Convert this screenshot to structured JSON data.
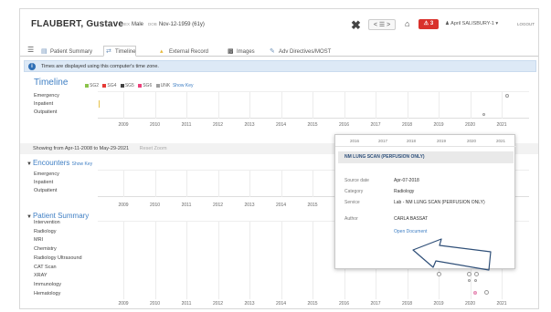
{
  "patient": {
    "name": "FLAUBERT, Gustave",
    "sex_label": "SEX",
    "sex": "Male",
    "dob_label": "DOB",
    "dob": "Nov-12-1959 (61y)"
  },
  "header": {
    "close_glyph": "✖",
    "list_glyph": "< ☰ >",
    "home_glyph": "⌂",
    "alert_count": "3",
    "user": "April SALISBURY-1",
    "logout": "LOGOUT"
  },
  "tabs": [
    {
      "label": "Patient Summary"
    },
    {
      "label": "Timeline"
    },
    {
      "label": "External Record"
    },
    {
      "label": "Images"
    },
    {
      "label": "Adv Directives/MOST"
    }
  ],
  "notice": "Times are displayed using this computer's time zone.",
  "timeline": {
    "title": "Timeline",
    "legend": [
      {
        "label": "SG2",
        "color": "#8bc34a"
      },
      {
        "label": "SG4",
        "color": "#e53935"
      },
      {
        "label": "SG5",
        "color": "#424242"
      },
      {
        "label": "SG6",
        "color": "#ec407a"
      },
      {
        "label": "UNK",
        "color": "#9e9e9e"
      }
    ],
    "show_key": "Show Key",
    "rows": [
      "Emergency",
      "Inpatient",
      "Outpatient"
    ],
    "years": [
      "2009",
      "2010",
      "2011",
      "2012",
      "2013",
      "2014",
      "2015",
      "2016",
      "2017",
      "2018",
      "2019",
      "2020",
      "2021"
    ]
  },
  "range": {
    "text": "Showing from Apr-11-2008 to May-29-2021",
    "reset": "Reset Zoom"
  },
  "encounters": {
    "title": "Encounters",
    "show_key": "Show Key",
    "rows": [
      "Emergency",
      "Inpatient",
      "Outpatient"
    ],
    "years": [
      "2009",
      "2010",
      "2011",
      "2012",
      "2013",
      "2014",
      "2015"
    ]
  },
  "summary": {
    "title": "Patient Summary",
    "rows": [
      "Intervention",
      "Radiology",
      "MRI",
      "Chemistry",
      "Radiology Ultrasound",
      "CAT Scan",
      "XRAY",
      "Immunology",
      "Hematology"
    ],
    "years": [
      "2009",
      "2010",
      "2011",
      "2012",
      "2013",
      "2014",
      "2015",
      "2016",
      "2017",
      "2018",
      "2019",
      "2020",
      "2021"
    ]
  },
  "popup": {
    "years": [
      "2016",
      "2017",
      "2018",
      "2019",
      "2020",
      "2021"
    ],
    "title": "NM LUNG SCAN (PERFUSION ONLY)",
    "fields": [
      {
        "label": "Source date",
        "value": "Apr-07-2018"
      },
      {
        "label": "Category",
        "value": "Radiology"
      },
      {
        "label": "Service",
        "value": "Lab - NM LUNG SCAN (PERFUSION ONLY)"
      },
      {
        "label": "Author",
        "value": "CARLA BASSAT"
      }
    ],
    "open_link": "Open Document"
  }
}
